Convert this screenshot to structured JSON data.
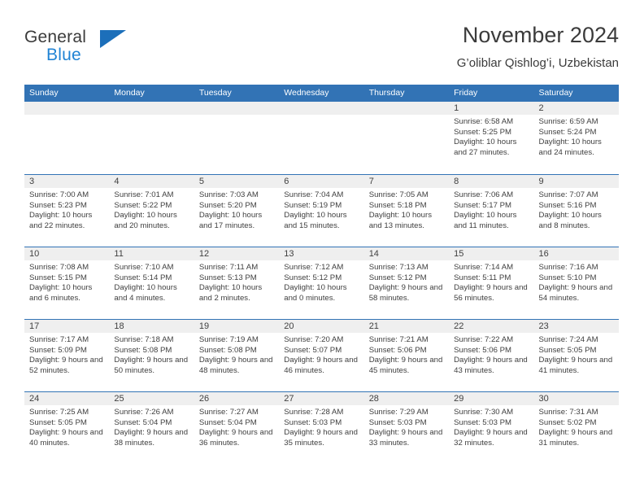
{
  "brand": {
    "name_part1": "General",
    "name_part2": "Blue",
    "accent_color": "#2083d4",
    "triangle_color": "#1c6fba"
  },
  "header": {
    "title": "November 2024",
    "subtitle": "G’oliblar Qishlog’i, Uzbekistan"
  },
  "theme": {
    "header_blue": "#3273b5",
    "day_strip_gray": "#efefef",
    "text_color": "#404040"
  },
  "calendar": {
    "weekdays": [
      "Sunday",
      "Monday",
      "Tuesday",
      "Wednesday",
      "Thursday",
      "Friday",
      "Saturday"
    ],
    "weeks": [
      [
        {
          "day": "",
          "empty": true
        },
        {
          "day": "",
          "empty": true
        },
        {
          "day": "",
          "empty": true
        },
        {
          "day": "",
          "empty": true
        },
        {
          "day": "",
          "empty": true
        },
        {
          "day": "1",
          "sunrise": "Sunrise: 6:58 AM",
          "sunset": "Sunset: 5:25 PM",
          "daylight": "Daylight: 10 hours and 27 minutes."
        },
        {
          "day": "2",
          "sunrise": "Sunrise: 6:59 AM",
          "sunset": "Sunset: 5:24 PM",
          "daylight": "Daylight: 10 hours and 24 minutes."
        }
      ],
      [
        {
          "day": "3",
          "sunrise": "Sunrise: 7:00 AM",
          "sunset": "Sunset: 5:23 PM",
          "daylight": "Daylight: 10 hours and 22 minutes."
        },
        {
          "day": "4",
          "sunrise": "Sunrise: 7:01 AM",
          "sunset": "Sunset: 5:22 PM",
          "daylight": "Daylight: 10 hours and 20 minutes."
        },
        {
          "day": "5",
          "sunrise": "Sunrise: 7:03 AM",
          "sunset": "Sunset: 5:20 PM",
          "daylight": "Daylight: 10 hours and 17 minutes."
        },
        {
          "day": "6",
          "sunrise": "Sunrise: 7:04 AM",
          "sunset": "Sunset: 5:19 PM",
          "daylight": "Daylight: 10 hours and 15 minutes."
        },
        {
          "day": "7",
          "sunrise": "Sunrise: 7:05 AM",
          "sunset": "Sunset: 5:18 PM",
          "daylight": "Daylight: 10 hours and 13 minutes."
        },
        {
          "day": "8",
          "sunrise": "Sunrise: 7:06 AM",
          "sunset": "Sunset: 5:17 PM",
          "daylight": "Daylight: 10 hours and 11 minutes."
        },
        {
          "day": "9",
          "sunrise": "Sunrise: 7:07 AM",
          "sunset": "Sunset: 5:16 PM",
          "daylight": "Daylight: 10 hours and 8 minutes."
        }
      ],
      [
        {
          "day": "10",
          "sunrise": "Sunrise: 7:08 AM",
          "sunset": "Sunset: 5:15 PM",
          "daylight": "Daylight: 10 hours and 6 minutes."
        },
        {
          "day": "11",
          "sunrise": "Sunrise: 7:10 AM",
          "sunset": "Sunset: 5:14 PM",
          "daylight": "Daylight: 10 hours and 4 minutes."
        },
        {
          "day": "12",
          "sunrise": "Sunrise: 7:11 AM",
          "sunset": "Sunset: 5:13 PM",
          "daylight": "Daylight: 10 hours and 2 minutes."
        },
        {
          "day": "13",
          "sunrise": "Sunrise: 7:12 AM",
          "sunset": "Sunset: 5:12 PM",
          "daylight": "Daylight: 10 hours and 0 minutes."
        },
        {
          "day": "14",
          "sunrise": "Sunrise: 7:13 AM",
          "sunset": "Sunset: 5:12 PM",
          "daylight": "Daylight: 9 hours and 58 minutes."
        },
        {
          "day": "15",
          "sunrise": "Sunrise: 7:14 AM",
          "sunset": "Sunset: 5:11 PM",
          "daylight": "Daylight: 9 hours and 56 minutes."
        },
        {
          "day": "16",
          "sunrise": "Sunrise: 7:16 AM",
          "sunset": "Sunset: 5:10 PM",
          "daylight": "Daylight: 9 hours and 54 minutes."
        }
      ],
      [
        {
          "day": "17",
          "sunrise": "Sunrise: 7:17 AM",
          "sunset": "Sunset: 5:09 PM",
          "daylight": "Daylight: 9 hours and 52 minutes."
        },
        {
          "day": "18",
          "sunrise": "Sunrise: 7:18 AM",
          "sunset": "Sunset: 5:08 PM",
          "daylight": "Daylight: 9 hours and 50 minutes."
        },
        {
          "day": "19",
          "sunrise": "Sunrise: 7:19 AM",
          "sunset": "Sunset: 5:08 PM",
          "daylight": "Daylight: 9 hours and 48 minutes."
        },
        {
          "day": "20",
          "sunrise": "Sunrise: 7:20 AM",
          "sunset": "Sunset: 5:07 PM",
          "daylight": "Daylight: 9 hours and 46 minutes."
        },
        {
          "day": "21",
          "sunrise": "Sunrise: 7:21 AM",
          "sunset": "Sunset: 5:06 PM",
          "daylight": "Daylight: 9 hours and 45 minutes."
        },
        {
          "day": "22",
          "sunrise": "Sunrise: 7:22 AM",
          "sunset": "Sunset: 5:06 PM",
          "daylight": "Daylight: 9 hours and 43 minutes."
        },
        {
          "day": "23",
          "sunrise": "Sunrise: 7:24 AM",
          "sunset": "Sunset: 5:05 PM",
          "daylight": "Daylight: 9 hours and 41 minutes."
        }
      ],
      [
        {
          "day": "24",
          "sunrise": "Sunrise: 7:25 AM",
          "sunset": "Sunset: 5:05 PM",
          "daylight": "Daylight: 9 hours and 40 minutes."
        },
        {
          "day": "25",
          "sunrise": "Sunrise: 7:26 AM",
          "sunset": "Sunset: 5:04 PM",
          "daylight": "Daylight: 9 hours and 38 minutes."
        },
        {
          "day": "26",
          "sunrise": "Sunrise: 7:27 AM",
          "sunset": "Sunset: 5:04 PM",
          "daylight": "Daylight: 9 hours and 36 minutes."
        },
        {
          "day": "27",
          "sunrise": "Sunrise: 7:28 AM",
          "sunset": "Sunset: 5:03 PM",
          "daylight": "Daylight: 9 hours and 35 minutes."
        },
        {
          "day": "28",
          "sunrise": "Sunrise: 7:29 AM",
          "sunset": "Sunset: 5:03 PM",
          "daylight": "Daylight: 9 hours and 33 minutes."
        },
        {
          "day": "29",
          "sunrise": "Sunrise: 7:30 AM",
          "sunset": "Sunset: 5:03 PM",
          "daylight": "Daylight: 9 hours and 32 minutes."
        },
        {
          "day": "30",
          "sunrise": "Sunrise: 7:31 AM",
          "sunset": "Sunset: 5:02 PM",
          "daylight": "Daylight: 9 hours and 31 minutes."
        }
      ]
    ]
  }
}
